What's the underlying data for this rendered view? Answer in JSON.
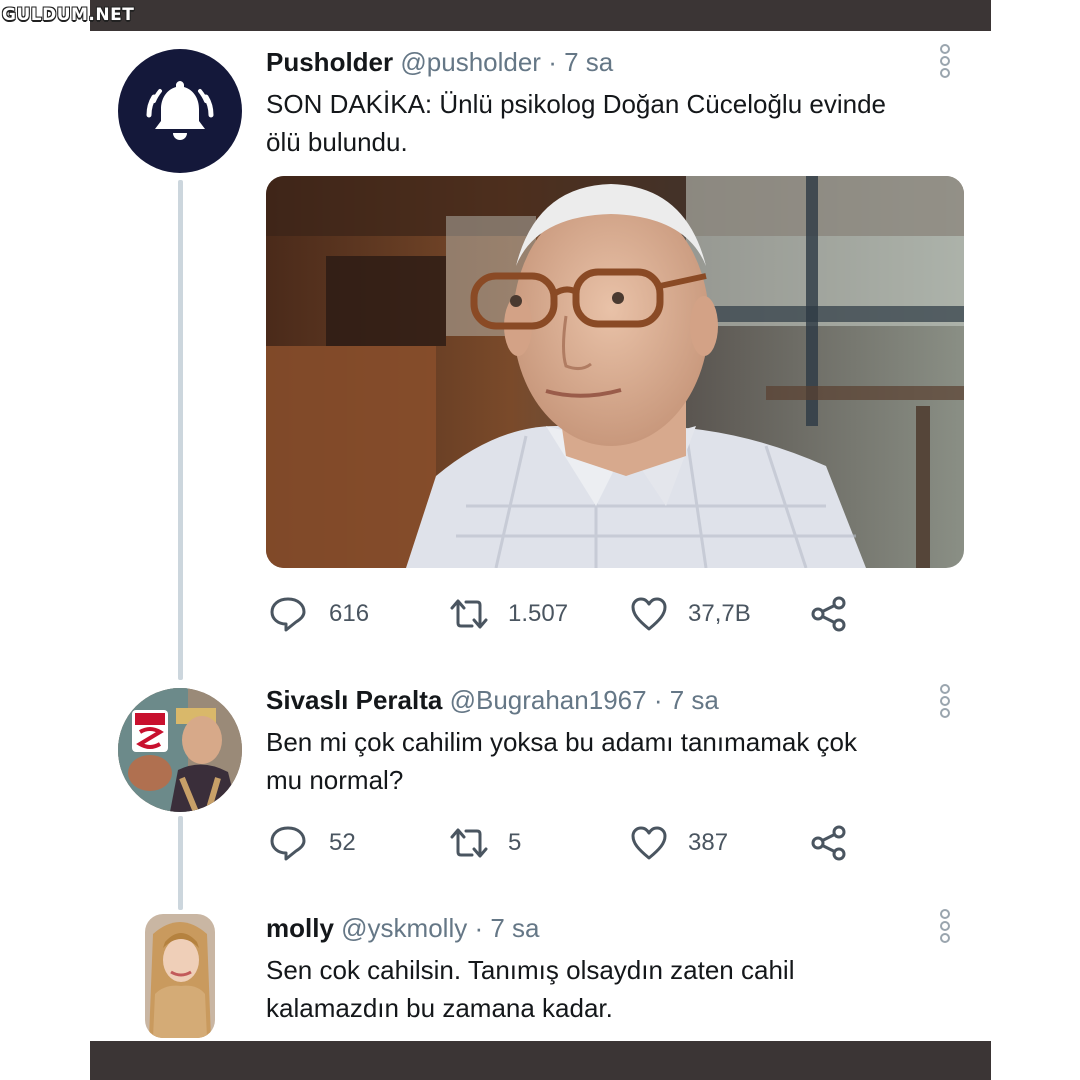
{
  "watermark": "GULDUM.NET",
  "tweets": [
    {
      "display_name": "Pusholder",
      "handle": "@pusholder",
      "time": "· 7 sa",
      "text_line1": "SON DAKİKA: Ünlü psikolog Doğan Cüceloğlu evinde",
      "text_line2": "ölü bulundu.",
      "avatar_icon": "bell-icon",
      "replies": "616",
      "retweets": "1.507",
      "likes": "37,7B"
    },
    {
      "display_name": "Sivaslı Peralta",
      "handle": "@Bugrahan1967",
      "time": "· 7 sa",
      "text_line1": "Ben mi çok cahilim yoksa bu adamı tanımamak çok",
      "text_line2": "mu normal?",
      "replies": "52",
      "retweets": "5",
      "likes": "387"
    },
    {
      "display_name": "molly",
      "handle": "@yskmolly",
      "time": "· 7 sa",
      "text_line1": "Sen cok cahilsin. Tanımış olsaydın zaten cahil",
      "text_line2": "kalamazdın bu zamana kadar."
    }
  ],
  "colors": {
    "frame_bar": "#3b3535",
    "thread_line": "#ccd6dd",
    "bell_avatar_bg": "#14183a",
    "muted_text": "#657786"
  }
}
